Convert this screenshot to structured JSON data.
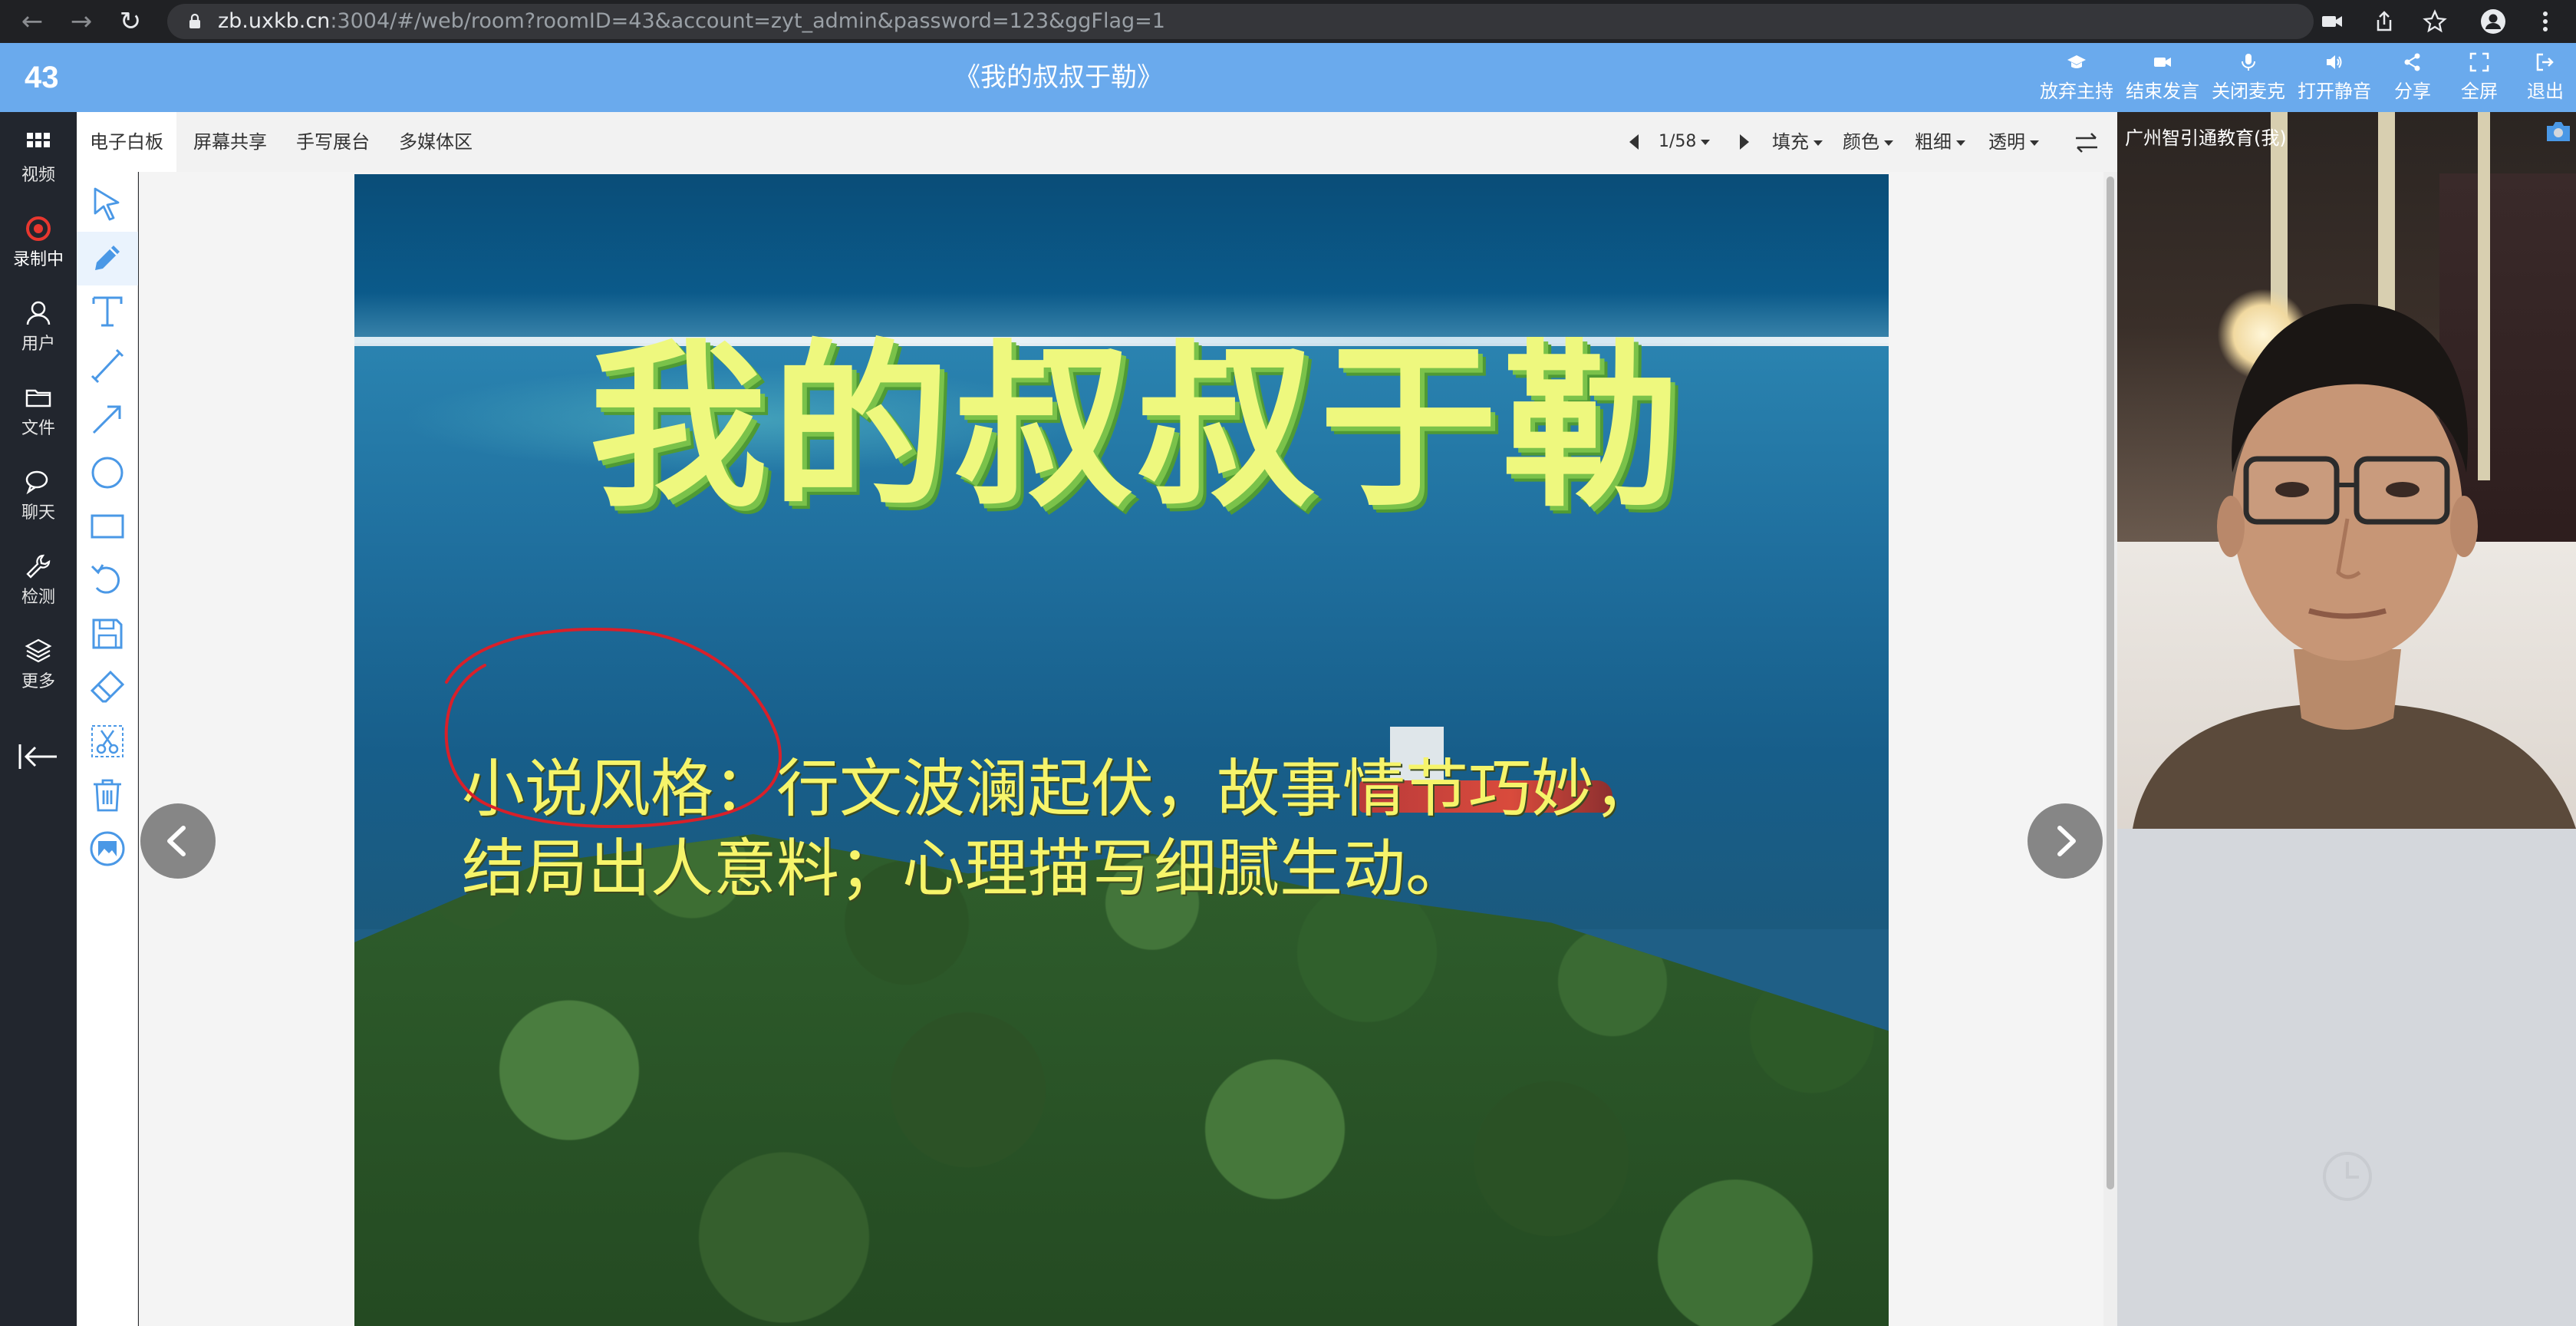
{
  "browser": {
    "url_host": "zb.uxkb.cn",
    "url_rest": ":3004/#/web/room?roomID=43&account=zyt_admin&password=123&ggFlag=1"
  },
  "header": {
    "room_id": "43",
    "title": "《我的叔叔于勒》",
    "buttons": [
      {
        "label": "放弃主持",
        "icon": "graduation-cap-icon"
      },
      {
        "label": "结束发言",
        "icon": "video-camera-icon"
      },
      {
        "label": "关闭麦克",
        "icon": "microphone-icon"
      },
      {
        "label": "打开静音",
        "icon": "speaker-icon"
      },
      {
        "label": "分享",
        "icon": "share-icon"
      },
      {
        "label": "全屏",
        "icon": "fullscreen-icon"
      },
      {
        "label": "退出",
        "icon": "sign-out-icon"
      }
    ]
  },
  "sidebar": {
    "items": [
      {
        "label": "视频",
        "icon": "grid-icon"
      },
      {
        "label": "录制中",
        "icon": "record-icon"
      },
      {
        "label": "用户",
        "icon": "user-icon"
      },
      {
        "label": "文件",
        "icon": "folder-icon"
      },
      {
        "label": "聊天",
        "icon": "chat-icon"
      },
      {
        "label": "检测",
        "icon": "wrench-icon"
      },
      {
        "label": "更多",
        "icon": "layers-icon"
      }
    ],
    "collapse_icon": "collapse-left-icon"
  },
  "tabs": [
    {
      "label": "电子白板",
      "active": true
    },
    {
      "label": "屏幕共享",
      "active": false
    },
    {
      "label": "手写展台",
      "active": false
    },
    {
      "label": "多媒体区",
      "active": false
    }
  ],
  "toolbar": {
    "page": "1/58",
    "fill_label": "填充",
    "color_label": "颜色",
    "thickness_label": "粗细",
    "opacity_label": "透明"
  },
  "tools": [
    "select-arrow-icon",
    "pencil-icon",
    "text-icon",
    "line-icon",
    "arrow-icon",
    "circle-icon",
    "rectangle-icon",
    "undo-icon",
    "save-icon",
    "eraser-icon",
    "cut-icon",
    "trash-icon",
    "image-icon"
  ],
  "slide": {
    "title": "我的叔叔于勒",
    "line1": "小说风格：行文波澜起伏，故事情节巧妙，",
    "line2": "结局出人意料；心理描写细腻生动。"
  },
  "video": {
    "participant_label": "广州智引通教育(我)"
  },
  "colors": {
    "header_bg": "#6aaaed",
    "sidebar_bg": "#22262e",
    "record_red": "#e8372f",
    "tool_blue": "#4a98e6",
    "ink_red": "#d8202a"
  }
}
